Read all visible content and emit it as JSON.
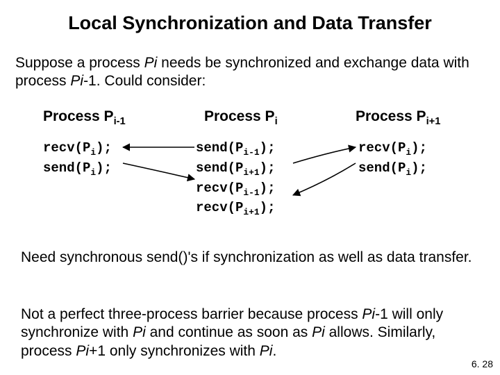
{
  "title": "Local Synchronization and Data Transfer",
  "intro": {
    "part1": "Suppose a process ",
    "pi": "Pi",
    "part2": " needs be synchronized and exchange data with process ",
    "pim1_a": "Pi",
    "pim1_b": "-1. Could consider:"
  },
  "heads": {
    "h1a": "Process P",
    "h1b": "i-1",
    "h2a": "Process P",
    "h2b": "i",
    "h3a": "Process P",
    "h3b": "i+1"
  },
  "col1": {
    "l1a": "recv(P",
    "l1b": "i",
    "l1c": ");",
    "l2a": "send(P",
    "l2b": "i",
    "l2c": ");"
  },
  "col2": {
    "l1a": "send(P",
    "l1b": "i-1",
    "l1c": ");",
    "l2a": "send(P",
    "l2b": "i+1",
    "l2c": ");",
    "l3a": "recv(P",
    "l3b": "i-1",
    "l3c": ");",
    "l4a": "recv(P",
    "l4b": "i+1",
    "l4c": ");"
  },
  "col3": {
    "l1a": "recv(P",
    "l1b": "i",
    "l1c": ");",
    "l2a": "send(P",
    "l2b": "i",
    "l2c": ");"
  },
  "para1": "Need synchronous send()'s  if synchronization as well as data transfer.",
  "para2": {
    "t1": "Not a perfect three-process barrier because process ",
    "t2": "Pi",
    "t3": "-1 will only synchronize with ",
    "t4": "Pi",
    "t5": " and continue as soon as ",
    "t6": "Pi",
    "t7": " allows. Similarly, process ",
    "t8": "Pi",
    "t9": "+1 only synchronizes with ",
    "t10": "Pi",
    "t11": "."
  },
  "footer": "6. 28"
}
